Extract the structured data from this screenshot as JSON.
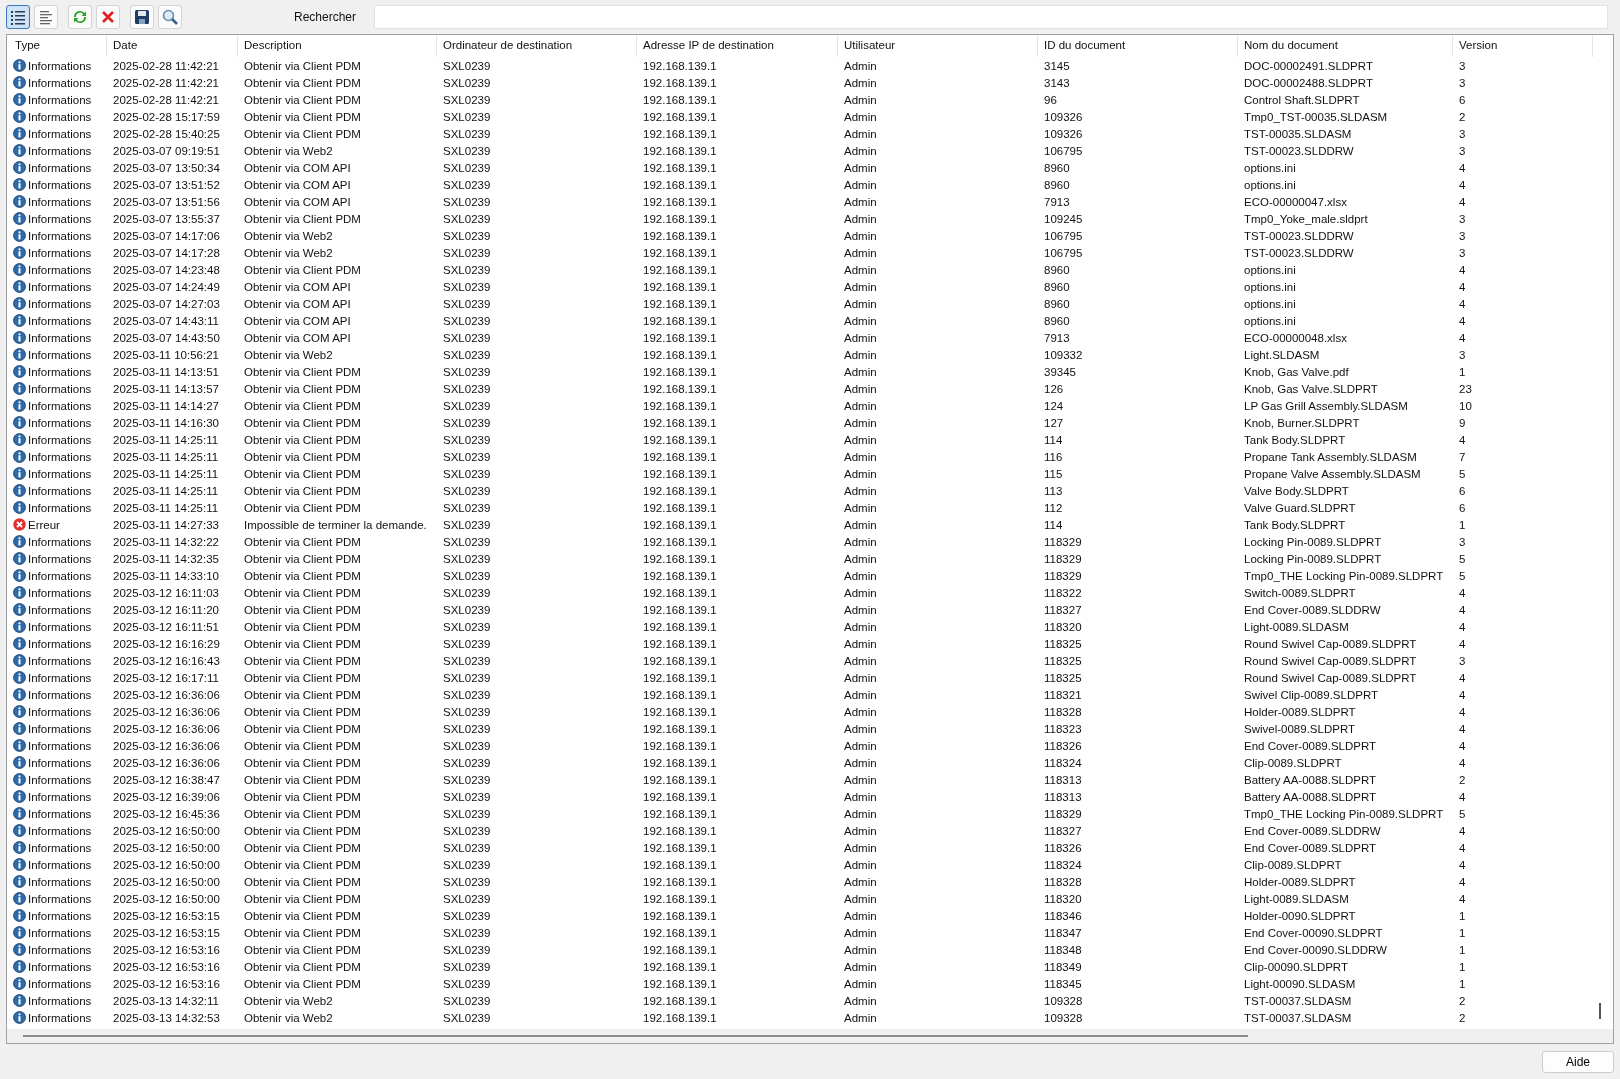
{
  "toolbar": {
    "buttons": [
      {
        "kind": "list",
        "selected": true
      },
      {
        "kind": "details",
        "selected": false
      },
      {
        "kind": "refresh",
        "selected": false
      },
      {
        "kind": "delete",
        "selected": false
      },
      {
        "kind": "save",
        "selected": false
      },
      {
        "kind": "search",
        "selected": false
      }
    ],
    "search_label": "Rechercher"
  },
  "table": {
    "columns": [
      "Type",
      "Date",
      "Description",
      "Ordinateur de destination",
      "Adresse IP de destination",
      "Utilisateur",
      "ID du document",
      "Nom du document",
      "Version"
    ],
    "rows": [
      {
        "kind": "info",
        "cells": [
          "Informations",
          "2025-02-28 11:42:21",
          "Obtenir via Client PDM",
          "SXL0239",
          "192.168.139.1",
          "Admin",
          "3145",
          "DOC-00002491.SLDPRT",
          "3"
        ]
      },
      {
        "kind": "info",
        "cells": [
          "Informations",
          "2025-02-28 11:42:21",
          "Obtenir via Client PDM",
          "SXL0239",
          "192.168.139.1",
          "Admin",
          "3143",
          "DOC-00002488.SLDPRT",
          "3"
        ]
      },
      {
        "kind": "info",
        "cells": [
          "Informations",
          "2025-02-28 11:42:21",
          "Obtenir via Client PDM",
          "SXL0239",
          "192.168.139.1",
          "Admin",
          "96",
          "Control Shaft.SLDPRT",
          "6"
        ]
      },
      {
        "kind": "info",
        "cells": [
          "Informations",
          "2025-02-28 15:17:59",
          "Obtenir via Client PDM",
          "SXL0239",
          "192.168.139.1",
          "Admin",
          "109326",
          "Tmp0_TST-00035.SLDASM",
          "2"
        ]
      },
      {
        "kind": "info",
        "cells": [
          "Informations",
          "2025-02-28 15:40:25",
          "Obtenir via Client PDM",
          "SXL0239",
          "192.168.139.1",
          "Admin",
          "109326",
          "TST-00035.SLDASM",
          "3"
        ]
      },
      {
        "kind": "info",
        "cells": [
          "Informations",
          "2025-03-07 09:19:51",
          "Obtenir via Web2",
          "SXL0239",
          "192.168.139.1",
          "Admin",
          "106795",
          "TST-00023.SLDDRW",
          "3"
        ]
      },
      {
        "kind": "info",
        "cells": [
          "Informations",
          "2025-03-07 13:50:34",
          "Obtenir via COM API",
          "SXL0239",
          "192.168.139.1",
          "Admin",
          "8960",
          "options.ini",
          "4"
        ]
      },
      {
        "kind": "info",
        "cells": [
          "Informations",
          "2025-03-07 13:51:52",
          "Obtenir via COM API",
          "SXL0239",
          "192.168.139.1",
          "Admin",
          "8960",
          "options.ini",
          "4"
        ]
      },
      {
        "kind": "info",
        "cells": [
          "Informations",
          "2025-03-07 13:51:56",
          "Obtenir via COM API",
          "SXL0239",
          "192.168.139.1",
          "Admin",
          "7913",
          "ECO-00000047.xlsx",
          "4"
        ]
      },
      {
        "kind": "info",
        "cells": [
          "Informations",
          "2025-03-07 13:55:37",
          "Obtenir via Client PDM",
          "SXL0239",
          "192.168.139.1",
          "Admin",
          "109245",
          "Tmp0_Yoke_male.sldprt",
          "3"
        ]
      },
      {
        "kind": "info",
        "cells": [
          "Informations",
          "2025-03-07 14:17:06",
          "Obtenir via Web2",
          "SXL0239",
          "192.168.139.1",
          "Admin",
          "106795",
          "TST-00023.SLDDRW",
          "3"
        ]
      },
      {
        "kind": "info",
        "cells": [
          "Informations",
          "2025-03-07 14:17:28",
          "Obtenir via Web2",
          "SXL0239",
          "192.168.139.1",
          "Admin",
          "106795",
          "TST-00023.SLDDRW",
          "3"
        ]
      },
      {
        "kind": "info",
        "cells": [
          "Informations",
          "2025-03-07 14:23:48",
          "Obtenir via Client PDM",
          "SXL0239",
          "192.168.139.1",
          "Admin",
          "8960",
          "options.ini",
          "4"
        ]
      },
      {
        "kind": "info",
        "cells": [
          "Informations",
          "2025-03-07 14:24:49",
          "Obtenir via COM API",
          "SXL0239",
          "192.168.139.1",
          "Admin",
          "8960",
          "options.ini",
          "4"
        ]
      },
      {
        "kind": "info",
        "cells": [
          "Informations",
          "2025-03-07 14:27:03",
          "Obtenir via COM API",
          "SXL0239",
          "192.168.139.1",
          "Admin",
          "8960",
          "options.ini",
          "4"
        ]
      },
      {
        "kind": "info",
        "cells": [
          "Informations",
          "2025-03-07 14:43:11",
          "Obtenir via COM API",
          "SXL0239",
          "192.168.139.1",
          "Admin",
          "8960",
          "options.ini",
          "4"
        ]
      },
      {
        "kind": "info",
        "cells": [
          "Informations",
          "2025-03-07 14:43:50",
          "Obtenir via COM API",
          "SXL0239",
          "192.168.139.1",
          "Admin",
          "7913",
          "ECO-00000048.xlsx",
          "4"
        ]
      },
      {
        "kind": "info",
        "cells": [
          "Informations",
          "2025-03-11 10:56:21",
          "Obtenir via Web2",
          "SXL0239",
          "192.168.139.1",
          "Admin",
          "109332",
          "Light.SLDASM",
          "3"
        ]
      },
      {
        "kind": "info",
        "cells": [
          "Informations",
          "2025-03-11 14:13:51",
          "Obtenir via Client PDM",
          "SXL0239",
          "192.168.139.1",
          "Admin",
          "39345",
          "Knob, Gas Valve.pdf",
          "1"
        ]
      },
      {
        "kind": "info",
        "cells": [
          "Informations",
          "2025-03-11 14:13:57",
          "Obtenir via Client PDM",
          "SXL0239",
          "192.168.139.1",
          "Admin",
          "126",
          "Knob, Gas Valve.SLDPRT",
          "23"
        ]
      },
      {
        "kind": "info",
        "cells": [
          "Informations",
          "2025-03-11 14:14:27",
          "Obtenir via Client PDM",
          "SXL0239",
          "192.168.139.1",
          "Admin",
          "124",
          "LP Gas Grill Assembly.SLDASM",
          "10"
        ]
      },
      {
        "kind": "info",
        "cells": [
          "Informations",
          "2025-03-11 14:16:30",
          "Obtenir via Client PDM",
          "SXL0239",
          "192.168.139.1",
          "Admin",
          "127",
          "Knob, Burner.SLDPRT",
          "9"
        ]
      },
      {
        "kind": "info",
        "cells": [
          "Informations",
          "2025-03-11 14:25:11",
          "Obtenir via Client PDM",
          "SXL0239",
          "192.168.139.1",
          "Admin",
          "114",
          "Tank Body.SLDPRT",
          "4"
        ]
      },
      {
        "kind": "info",
        "cells": [
          "Informations",
          "2025-03-11 14:25:11",
          "Obtenir via Client PDM",
          "SXL0239",
          "192.168.139.1",
          "Admin",
          "116",
          "Propane Tank Assembly.SLDASM",
          "7"
        ]
      },
      {
        "kind": "info",
        "cells": [
          "Informations",
          "2025-03-11 14:25:11",
          "Obtenir via Client PDM",
          "SXL0239",
          "192.168.139.1",
          "Admin",
          "115",
          "Propane Valve Assembly.SLDASM",
          "5"
        ]
      },
      {
        "kind": "info",
        "cells": [
          "Informations",
          "2025-03-11 14:25:11",
          "Obtenir via Client PDM",
          "SXL0239",
          "192.168.139.1",
          "Admin",
          "113",
          "Valve Body.SLDPRT",
          "6"
        ]
      },
      {
        "kind": "info",
        "cells": [
          "Informations",
          "2025-03-11 14:25:11",
          "Obtenir via Client PDM",
          "SXL0239",
          "192.168.139.1",
          "Admin",
          "112",
          "Valve Guard.SLDPRT",
          "6"
        ]
      },
      {
        "kind": "error",
        "cells": [
          "Erreur",
          "2025-03-11 14:27:33",
          "Impossible de terminer la demande.",
          "SXL0239",
          "192.168.139.1",
          "Admin",
          "114",
          "Tank Body.SLDPRT",
          "1"
        ]
      },
      {
        "kind": "info",
        "cells": [
          "Informations",
          "2025-03-11 14:32:22",
          "Obtenir via Client PDM",
          "SXL0239",
          "192.168.139.1",
          "Admin",
          "118329",
          "Locking Pin-0089.SLDPRT",
          "3"
        ]
      },
      {
        "kind": "info",
        "cells": [
          "Informations",
          "2025-03-11 14:32:35",
          "Obtenir via Client PDM",
          "SXL0239",
          "192.168.139.1",
          "Admin",
          "118329",
          "Locking Pin-0089.SLDPRT",
          "5"
        ]
      },
      {
        "kind": "info",
        "cells": [
          "Informations",
          "2025-03-11 14:33:10",
          "Obtenir via Client PDM",
          "SXL0239",
          "192.168.139.1",
          "Admin",
          "118329",
          "Tmp0_THE Locking Pin-0089.SLDPRT",
          "5"
        ]
      },
      {
        "kind": "info",
        "cells": [
          "Informations",
          "2025-03-12 16:11:03",
          "Obtenir via Client PDM",
          "SXL0239",
          "192.168.139.1",
          "Admin",
          "118322",
          "Switch-0089.SLDPRT",
          "4"
        ]
      },
      {
        "kind": "info",
        "cells": [
          "Informations",
          "2025-03-12 16:11:20",
          "Obtenir via Client PDM",
          "SXL0239",
          "192.168.139.1",
          "Admin",
          "118327",
          "End Cover-0089.SLDDRW",
          "4"
        ]
      },
      {
        "kind": "info",
        "cells": [
          "Informations",
          "2025-03-12 16:11:51",
          "Obtenir via Client PDM",
          "SXL0239",
          "192.168.139.1",
          "Admin",
          "118320",
          "Light-0089.SLDASM",
          "4"
        ]
      },
      {
        "kind": "info",
        "cells": [
          "Informations",
          "2025-03-12 16:16:29",
          "Obtenir via Client PDM",
          "SXL0239",
          "192.168.139.1",
          "Admin",
          "118325",
          "Round Swivel Cap-0089.SLDPRT",
          "4"
        ]
      },
      {
        "kind": "info",
        "cells": [
          "Informations",
          "2025-03-12 16:16:43",
          "Obtenir via Client PDM",
          "SXL0239",
          "192.168.139.1",
          "Admin",
          "118325",
          "Round Swivel Cap-0089.SLDPRT",
          "3"
        ]
      },
      {
        "kind": "info",
        "cells": [
          "Informations",
          "2025-03-12 16:17:11",
          "Obtenir via Client PDM",
          "SXL0239",
          "192.168.139.1",
          "Admin",
          "118325",
          "Round Swivel Cap-0089.SLDPRT",
          "4"
        ]
      },
      {
        "kind": "info",
        "cells": [
          "Informations",
          "2025-03-12 16:36:06",
          "Obtenir via Client PDM",
          "SXL0239",
          "192.168.139.1",
          "Admin",
          "118321",
          "Swivel Clip-0089.SLDPRT",
          "4"
        ]
      },
      {
        "kind": "info",
        "cells": [
          "Informations",
          "2025-03-12 16:36:06",
          "Obtenir via Client PDM",
          "SXL0239",
          "192.168.139.1",
          "Admin",
          "118328",
          "Holder-0089.SLDPRT",
          "4"
        ]
      },
      {
        "kind": "info",
        "cells": [
          "Informations",
          "2025-03-12 16:36:06",
          "Obtenir via Client PDM",
          "SXL0239",
          "192.168.139.1",
          "Admin",
          "118323",
          "Swivel-0089.SLDPRT",
          "4"
        ]
      },
      {
        "kind": "info",
        "cells": [
          "Informations",
          "2025-03-12 16:36:06",
          "Obtenir via Client PDM",
          "SXL0239",
          "192.168.139.1",
          "Admin",
          "118326",
          "End Cover-0089.SLDPRT",
          "4"
        ]
      },
      {
        "kind": "info",
        "cells": [
          "Informations",
          "2025-03-12 16:36:06",
          "Obtenir via Client PDM",
          "SXL0239",
          "192.168.139.1",
          "Admin",
          "118324",
          "Clip-0089.SLDPRT",
          "4"
        ]
      },
      {
        "kind": "info",
        "cells": [
          "Informations",
          "2025-03-12 16:38:47",
          "Obtenir via Client PDM",
          "SXL0239",
          "192.168.139.1",
          "Admin",
          "118313",
          "Battery AA-0088.SLDPRT",
          "2"
        ]
      },
      {
        "kind": "info",
        "cells": [
          "Informations",
          "2025-03-12 16:39:06",
          "Obtenir via Client PDM",
          "SXL0239",
          "192.168.139.1",
          "Admin",
          "118313",
          "Battery AA-0088.SLDPRT",
          "4"
        ]
      },
      {
        "kind": "info",
        "cells": [
          "Informations",
          "2025-03-12 16:45:36",
          "Obtenir via Client PDM",
          "SXL0239",
          "192.168.139.1",
          "Admin",
          "118329",
          "Tmp0_THE Locking Pin-0089.SLDPRT",
          "5"
        ]
      },
      {
        "kind": "info",
        "cells": [
          "Informations",
          "2025-03-12 16:50:00",
          "Obtenir via Client PDM",
          "SXL0239",
          "192.168.139.1",
          "Admin",
          "118327",
          "End Cover-0089.SLDDRW",
          "4"
        ]
      },
      {
        "kind": "info",
        "cells": [
          "Informations",
          "2025-03-12 16:50:00",
          "Obtenir via Client PDM",
          "SXL0239",
          "192.168.139.1",
          "Admin",
          "118326",
          "End Cover-0089.SLDPRT",
          "4"
        ]
      },
      {
        "kind": "info",
        "cells": [
          "Informations",
          "2025-03-12 16:50:00",
          "Obtenir via Client PDM",
          "SXL0239",
          "192.168.139.1",
          "Admin",
          "118324",
          "Clip-0089.SLDPRT",
          "4"
        ]
      },
      {
        "kind": "info",
        "cells": [
          "Informations",
          "2025-03-12 16:50:00",
          "Obtenir via Client PDM",
          "SXL0239",
          "192.168.139.1",
          "Admin",
          "118328",
          "Holder-0089.SLDPRT",
          "4"
        ]
      },
      {
        "kind": "info",
        "cells": [
          "Informations",
          "2025-03-12 16:50:00",
          "Obtenir via Client PDM",
          "SXL0239",
          "192.168.139.1",
          "Admin",
          "118320",
          "Light-0089.SLDASM",
          "4"
        ]
      },
      {
        "kind": "info",
        "cells": [
          "Informations",
          "2025-03-12 16:53:15",
          "Obtenir via Client PDM",
          "SXL0239",
          "192.168.139.1",
          "Admin",
          "118346",
          "Holder-0090.SLDPRT",
          "1"
        ]
      },
      {
        "kind": "info",
        "cells": [
          "Informations",
          "2025-03-12 16:53:15",
          "Obtenir via Client PDM",
          "SXL0239",
          "192.168.139.1",
          "Admin",
          "118347",
          "End Cover-00090.SLDPRT",
          "1"
        ]
      },
      {
        "kind": "info",
        "cells": [
          "Informations",
          "2025-03-12 16:53:16",
          "Obtenir via Client PDM",
          "SXL0239",
          "192.168.139.1",
          "Admin",
          "118348",
          "End Cover-00090.SLDDRW",
          "1"
        ]
      },
      {
        "kind": "info",
        "cells": [
          "Informations",
          "2025-03-12 16:53:16",
          "Obtenir via Client PDM",
          "SXL0239",
          "192.168.139.1",
          "Admin",
          "118349",
          "Clip-00090.SLDPRT",
          "1"
        ]
      },
      {
        "kind": "info",
        "cells": [
          "Informations",
          "2025-03-12 16:53:16",
          "Obtenir via Client PDM",
          "SXL0239",
          "192.168.139.1",
          "Admin",
          "118345",
          "Light-00090.SLDASM",
          "1"
        ]
      },
      {
        "kind": "info",
        "cells": [
          "Informations",
          "2025-03-13 14:32:11",
          "Obtenir via Web2",
          "SXL0239",
          "192.168.139.1",
          "Admin",
          "109328",
          "TST-00037.SLDASM",
          "2"
        ]
      },
      {
        "kind": "info",
        "cells": [
          "Informations",
          "2025-03-13 14:32:53",
          "Obtenir via Web2",
          "SXL0239",
          "192.168.139.1",
          "Admin",
          "109328",
          "TST-00037.SLDASM",
          "2"
        ]
      }
    ]
  },
  "footer": {
    "help_button": "Aide"
  }
}
